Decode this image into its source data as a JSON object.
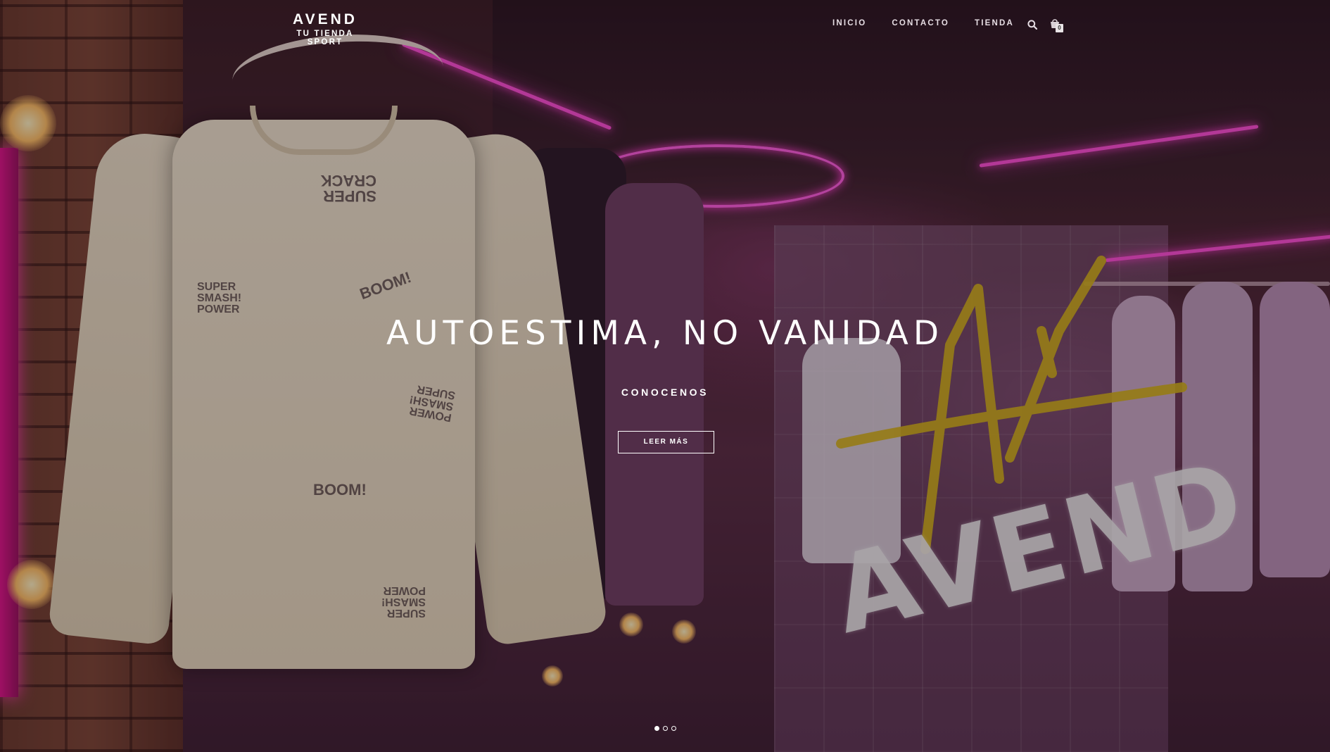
{
  "header": {
    "brand_name": "AVEND",
    "brand_tagline": "TU TIENDA SPORT",
    "nav": [
      {
        "label": "INICIO"
      },
      {
        "label": "CONTACTO"
      },
      {
        "label": "TIENDA"
      }
    ],
    "search_icon": "search-icon",
    "cart_icon": "shopping-bag-icon",
    "cart_count": "0"
  },
  "hero": {
    "title": "AUTOESTIMA, NO VANIDAD",
    "subtitle": "CONOCENOS",
    "button_label": "LEER MÁS",
    "slide_count": 3,
    "active_slide": 1,
    "sign_text": "AVEND",
    "sweater_prints": [
      "SUPER CRACK",
      "BOOM!",
      "SUPER SMASH! POWER",
      "POWER SMASH! SUPER",
      "SUPER SMASH! POWER",
      "BOOM!"
    ],
    "colors": {
      "neon": "#ff4fd8",
      "gold": "#d4b21c",
      "overlay": "#140810"
    }
  }
}
